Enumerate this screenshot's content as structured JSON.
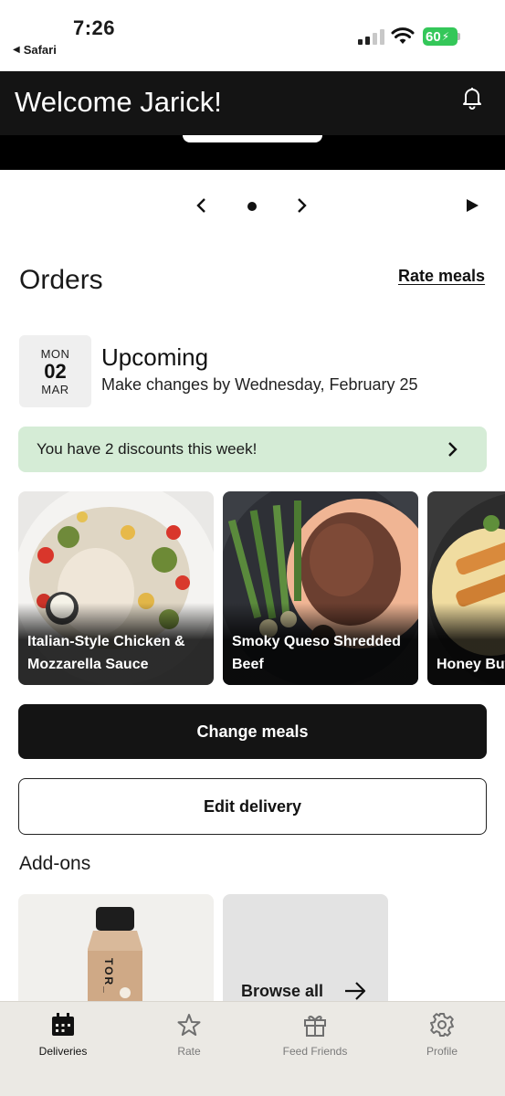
{
  "status_bar": {
    "time": "7:26",
    "back_app": "Safari",
    "battery": "60"
  },
  "header": {
    "title": "Welcome Jarick!",
    "bell_icon": "bell-icon"
  },
  "carousel": {
    "prev_icon": "chevron-left-icon",
    "next_icon": "chevron-right-icon",
    "play_icon": "play-icon"
  },
  "orders": {
    "title": "Orders",
    "rate_link": "Rate meals",
    "date": {
      "dow": "MON",
      "day": "02",
      "month": "MAR"
    },
    "status_title": "Upcoming",
    "status_sub": "Make changes by Wednesday, February 25",
    "discount": "You have 2 discounts this week!",
    "meals": [
      {
        "name": "Italian-Style Chicken & Mozzarella Sauce"
      },
      {
        "name": "Smoky Queso Shredded Beef"
      },
      {
        "name": "Honey Butter Breast"
      }
    ],
    "change_meals": "Change meals",
    "edit_delivery": "Edit delivery"
  },
  "addons": {
    "title": "Add-ons",
    "bottle_text": "TOR_",
    "browse_all": "Browse all"
  },
  "tabs": [
    {
      "label": "Deliveries",
      "icon": "calendar-icon",
      "active": true
    },
    {
      "label": "Rate",
      "icon": "star-icon",
      "active": false
    },
    {
      "label": "Feed Friends",
      "icon": "gift-icon",
      "active": false
    },
    {
      "label": "Profile",
      "icon": "gear-icon",
      "active": false
    }
  ],
  "colors": {
    "dark": "#141414",
    "discount_bg": "#d5ecd6",
    "battery": "#34c759",
    "tab_bar": "#ebe9e4"
  }
}
